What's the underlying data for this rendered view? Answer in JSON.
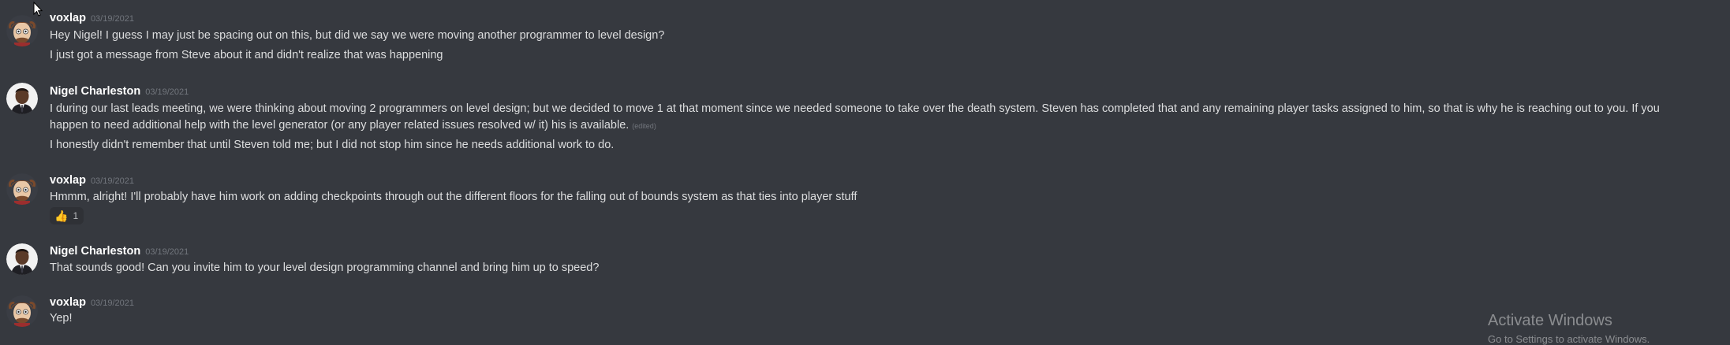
{
  "messages": [
    {
      "author": "voxlap",
      "timestamp": "03/19/2021",
      "lines": [
        "Hey Nigel! I guess I may just be spacing out on this, but did we say we were moving another programmer to level design?",
        "I just got a message from Steve about it and didn't realize that was happening"
      ]
    },
    {
      "author": "Nigel Charleston",
      "timestamp": "03/19/2021",
      "lines": [
        "I during our last leads meeting, we were thinking about moving 2 programmers on level design; but we decided to move 1 at that moment since we needed someone to take over the death system. Steven has completed that and any remaining player tasks assigned to him, so that is why he is reaching out to you. If you",
        "happen to need additional help with the level generator (or any player related issues resolved w/ it) his is available.",
        "I honestly didn't remember that until Steven told me; but I did not stop him since he needs additional work to do."
      ],
      "edited_label": "(edited)"
    },
    {
      "author": "voxlap",
      "timestamp": "03/19/2021",
      "lines": [
        "Hmmm, alright! I'll probably have him work on adding checkpoints through out the different floors for the falling out of bounds system as that ties into player stuff"
      ],
      "reaction": {
        "emoji": "👍",
        "count": "1"
      }
    },
    {
      "author": "Nigel Charleston",
      "timestamp": "03/19/2021",
      "lines": [
        "That sounds good! Can you invite him to your level design programming channel and bring him up to speed?"
      ]
    },
    {
      "author": "voxlap",
      "timestamp": "03/19/2021",
      "lines": [
        "Yep!"
      ]
    }
  ],
  "watermark": {
    "title": "Activate Windows",
    "subtitle": "Go to Settings to activate Windows."
  },
  "colors": {
    "background": "#36393f",
    "author": "#ffffff",
    "text": "#dcddde",
    "muted": "#72767d",
    "reaction_bg": "#2f3136"
  },
  "icons": {
    "cursor": "mouse-pointer-icon",
    "reaction": "thumbs-up-emoji"
  }
}
